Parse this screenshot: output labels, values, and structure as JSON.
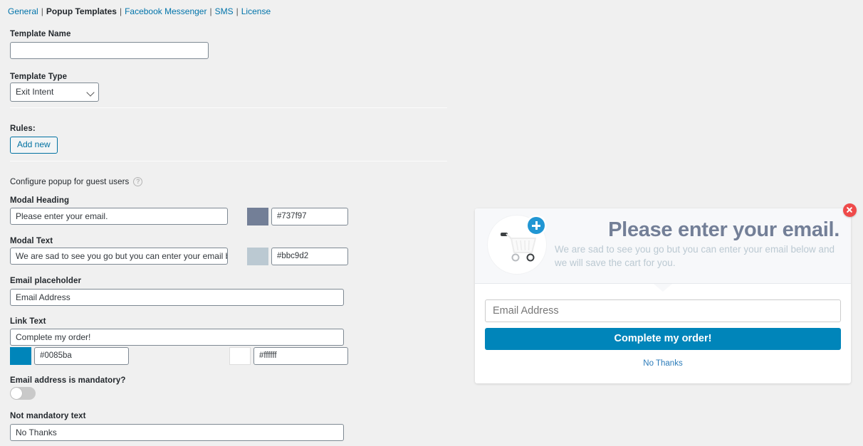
{
  "nav": {
    "items": [
      {
        "label": "General",
        "current": false
      },
      {
        "label": "Popup Templates",
        "current": true
      },
      {
        "label": "Facebook Messenger",
        "current": false
      },
      {
        "label": "SMS",
        "current": false
      },
      {
        "label": "License",
        "current": false
      }
    ],
    "separator": "|"
  },
  "form": {
    "template_name": {
      "label": "Template Name",
      "value": ""
    },
    "template_type": {
      "label": "Template Type",
      "value": "Exit Intent"
    },
    "rules": {
      "label": "Rules:",
      "add_button": "Add new"
    },
    "configure": {
      "label": "Configure popup for guest users",
      "help_glyph": "?"
    },
    "modal_heading": {
      "label": "Modal Heading",
      "value": "Please enter your email.",
      "color_hex": "#737f97"
    },
    "modal_text": {
      "label": "Modal Text",
      "value": "We are sad to see you go but you can enter your email below a",
      "color_hex": "#bbc9d2"
    },
    "email_placeholder": {
      "label": "Email placeholder",
      "value": "Email Address"
    },
    "link_text": {
      "label": "Link Text",
      "value": "Complete my order!",
      "bg_hex": "#0085ba",
      "text_hex": "#ffffff"
    },
    "mandatory": {
      "label": "Email address is mandatory?",
      "state": "off"
    },
    "not_mandatory_text": {
      "label": "Not mandatory text",
      "value": "No Thanks"
    }
  },
  "preview": {
    "heading": "Please enter your email.",
    "text": "We are sad to see you go but you can enter your email below and we will save the cart for you.",
    "email_placeholder": "Email Address",
    "button_label": "Complete my order!",
    "decline_link": "No Thanks",
    "heading_color": "#737f97",
    "text_color": "#bbc9d2",
    "button_bg": "#0085ba",
    "button_text_color": "#ffffff",
    "close_color": "#ef4a4a",
    "badge_color": "#2196d3"
  }
}
